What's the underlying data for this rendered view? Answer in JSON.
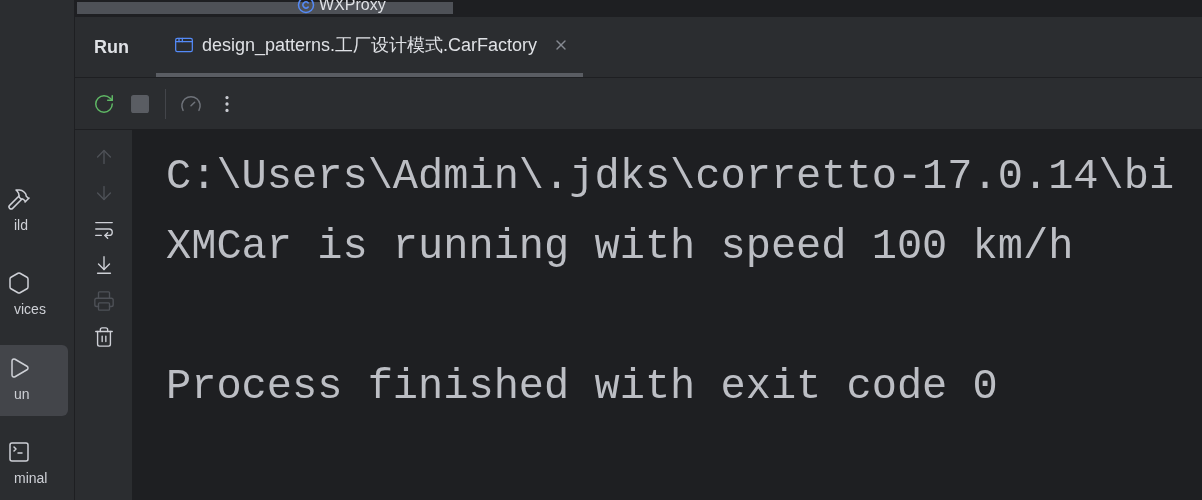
{
  "top_bar": {
    "title": "WXProxy"
  },
  "sidebar": {
    "items": [
      {
        "label": "ild",
        "kind": "build",
        "selected": false
      },
      {
        "label": "vices",
        "kind": "services",
        "selected": false
      },
      {
        "label": "un",
        "kind": "run",
        "selected": true
      },
      {
        "label": "minal",
        "kind": "terminal",
        "selected": false
      }
    ]
  },
  "run_panel": {
    "title": "Run",
    "tabs": [
      {
        "label": "design_patterns.工厂设计模式.CarFactory",
        "selected": true
      }
    ],
    "toolbar": [
      {
        "kind": "rerun",
        "disabled": false
      },
      {
        "kind": "stop",
        "disabled": true
      },
      {
        "kind": "profile",
        "disabled": true
      },
      {
        "kind": "more",
        "disabled": false
      }
    ],
    "gutter": [
      {
        "kind": "up",
        "disabled": true
      },
      {
        "kind": "down",
        "disabled": true
      },
      {
        "kind": "wrap",
        "disabled": false
      },
      {
        "kind": "scroll-end",
        "disabled": false
      },
      {
        "kind": "print",
        "disabled": true
      },
      {
        "kind": "clear",
        "disabled": false
      }
    ],
    "console": {
      "output": [
        "C:\\Users\\Admin\\.jdks\\corretto-17.0.14\\bi",
        "XMCar is running with speed 100 km/h"
      ],
      "exit_message": "Process finished with exit code 0"
    }
  }
}
